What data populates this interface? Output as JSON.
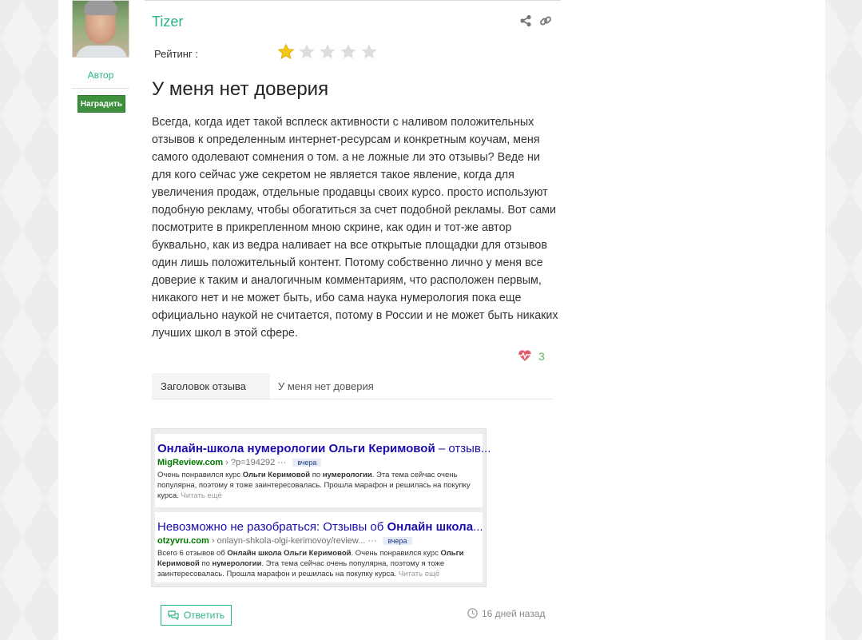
{
  "author": {
    "role": "Автор",
    "reward_label": "Наградить"
  },
  "review": {
    "username": "Tizer",
    "rating_label": "Рейтинг :",
    "rating": 1,
    "rating_max": 5,
    "title": "У меня нет доверия",
    "text": "Всегда, когда идет такой всплеск активности с наливом положительных отзывов к определенным интернет-ресурсам и конкретным коучам, меня самого одолевают сомнения о том. а не ложные ли это отзывы? Веде ни для кого сейчас уже секретом не является такое явление, когда для увеличения продаж, отдельные продавцы своих курсо. просто используют подобную рекламу, чтобы обогатиться за счет подобной рекламы. Вот сами посмотрите в прикрепленном мною скрине, как один и тот-же автор буквально, как из ведра наливает на все открытые площадки для отзывов один лишь положительный контент. Потому собственно лично у меня все доверие к таким и аналогичным комментариям, что расположен первым, никакого нет и не может быть, ибо сама наука нумерология пока еще официально наукой не считается, потому в России и не может быть никаких лучших школ в этой сфере.",
    "likes": "3",
    "field_label": "Заголовок отзыва",
    "field_value": "У меня нет доверия",
    "reply_label": "Ответить",
    "time_ago": "16 дней назад"
  },
  "attachment": {
    "results": [
      {
        "title_bold": "Онлайн-школа нумерологии Ольги Керимовой",
        "title_rest": " – отзыв...",
        "domain": "MigReview.com",
        "path": " › ?p=194292 ···",
        "badge": "вчера",
        "snippet_1": "Очень понравился курс ",
        "snippet_b1": "Ольги Керимовой",
        "snippet_2": " по ",
        "snippet_b2": "нумерологии",
        "snippet_3": ". Эта тема сейчас очень популярна, поэтому я тоже заинтересовалась. Прошла марафон и решилась на покупку курса.",
        "more": " Читать ещё"
      },
      {
        "title_plain": "Невозможно не разобраться: Отзывы об ",
        "title_bold": "Онлайн школа",
        "title_rest": "...",
        "domain": "otzyvru.com",
        "path": " › onlayn-shkola-olgi-kerimovoy/review... ···",
        "badge": "вчера",
        "snippet_1": "Всего 6 отзывов об ",
        "snippet_b1": "Онлайн школа Ольги Керимовой",
        "snippet_2": ". Очень понравился курс ",
        "snippet_b2": "Ольги Керимовой",
        "snippet_3": " по ",
        "snippet_b3": "нумерологии",
        "snippet_4": ". Эта тема сейчас очень популярна, поэтому я тоже заинтересовалась. Прошла марафон и решилась на покупку курса.",
        "more": " Читать ещё"
      }
    ]
  },
  "colors": {
    "accent": "#2bb38a",
    "star_filled": "#f5c518",
    "star_empty": "#dddddd",
    "reward": "#3e8f3e"
  }
}
